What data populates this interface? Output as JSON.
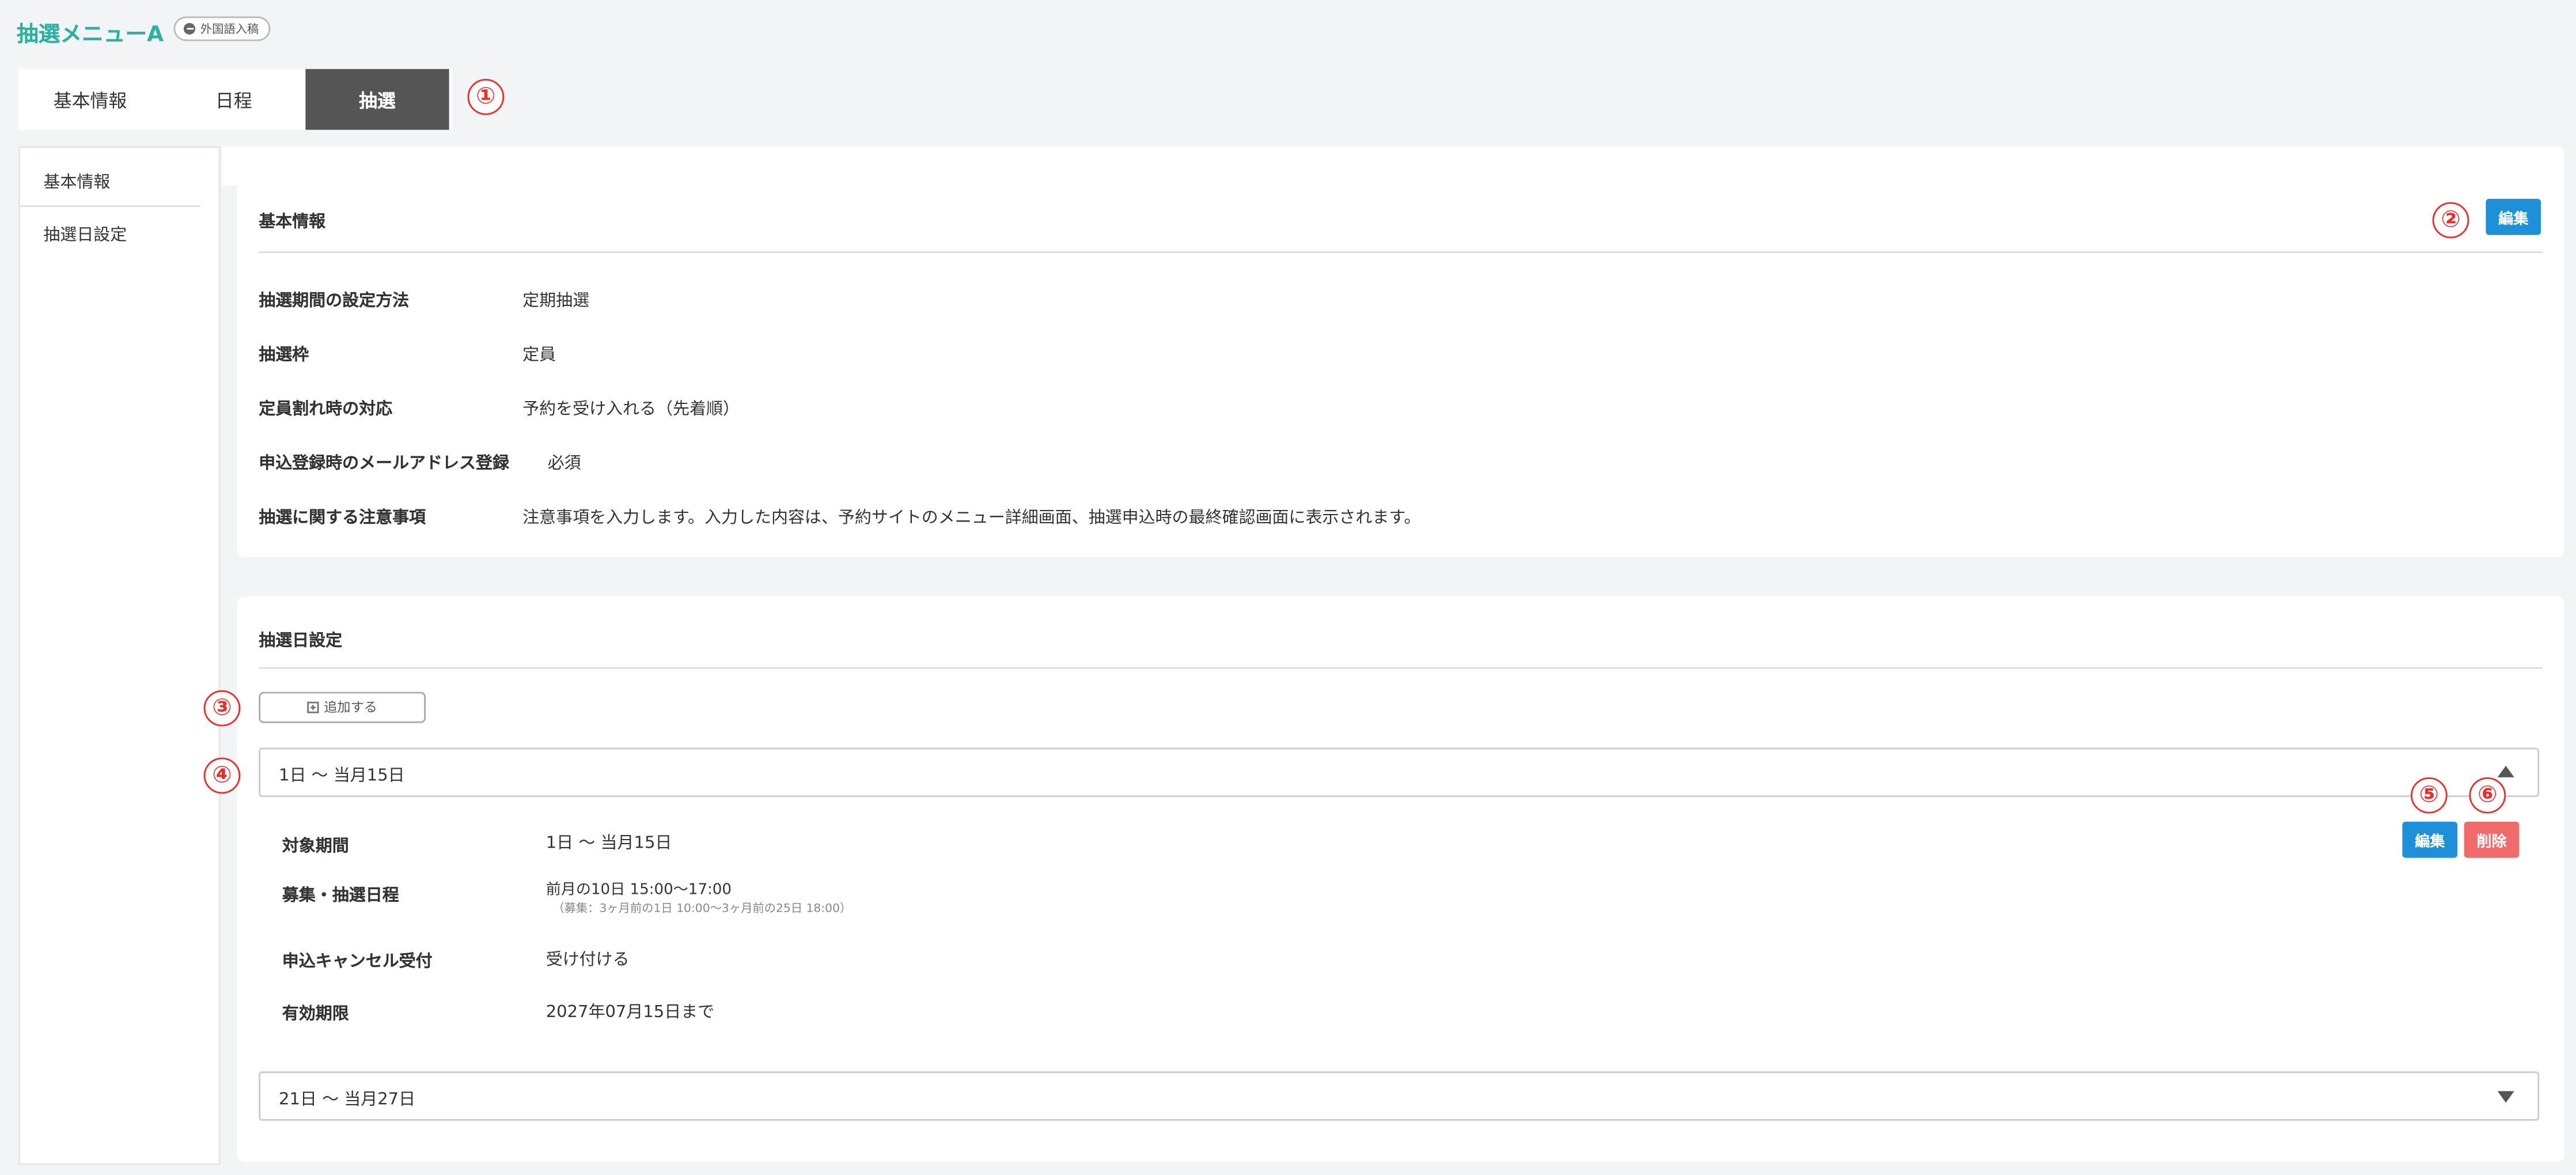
{
  "header": {
    "title": "抽選メニューA",
    "badge": "外国語入稿"
  },
  "tabs": [
    {
      "label": "基本情報"
    },
    {
      "label": "日程"
    },
    {
      "label": "抽選"
    }
  ],
  "markers": [
    "①",
    "②",
    "③",
    "④",
    "⑤",
    "⑥"
  ],
  "sidenav": {
    "items": [
      {
        "label": "基本情報"
      },
      {
        "label": "抽選日設定"
      }
    ],
    "collapse_label": "«"
  },
  "basic_info": {
    "title": "基本情報",
    "edit_label": "編集",
    "rows": [
      {
        "label": "抽選期間の設定方法",
        "value": "定期抽選"
      },
      {
        "label": "抽選枠",
        "value": "定員"
      },
      {
        "label": "定員割れ時の対応",
        "value": "予約を受け入れる（先着順）"
      },
      {
        "label": "申込登録時のメールアドレス登録",
        "value": "必須"
      },
      {
        "label": "抽選に関する注意事項",
        "value": "注意事項を入力します。入力した内容は、予約サイトのメニュー詳細画面、抽選申込時の最終確認画面に表示されます。"
      }
    ]
  },
  "lottery_dates": {
    "title": "抽選日設定",
    "add_label": "追加する",
    "items": [
      {
        "header": "1日 〜 当月15日",
        "expanded": true,
        "edit_label": "編集",
        "delete_label": "削除",
        "details": [
          {
            "label": "対象期間",
            "value": "1日 〜 当月15日"
          },
          {
            "label": "募集・抽選日程",
            "value": "前月の10日 15:00〜17:00",
            "sub": "（募集：3ヶ月前の1日 10:00〜3ヶ月前の25日 18:00）"
          },
          {
            "label": "申込キャンセル受付",
            "value": "受け付ける"
          },
          {
            "label": "有効期限",
            "value": "2027年07月15日まで"
          }
        ]
      },
      {
        "header": "21日 〜 当月27日",
        "expanded": false
      }
    ]
  },
  "colors": {
    "accent": "#2eb1a3",
    "primary": "#1e90d9",
    "danger": "#f26b6b",
    "active_tab": "#555555",
    "marker": "#e8302b"
  }
}
